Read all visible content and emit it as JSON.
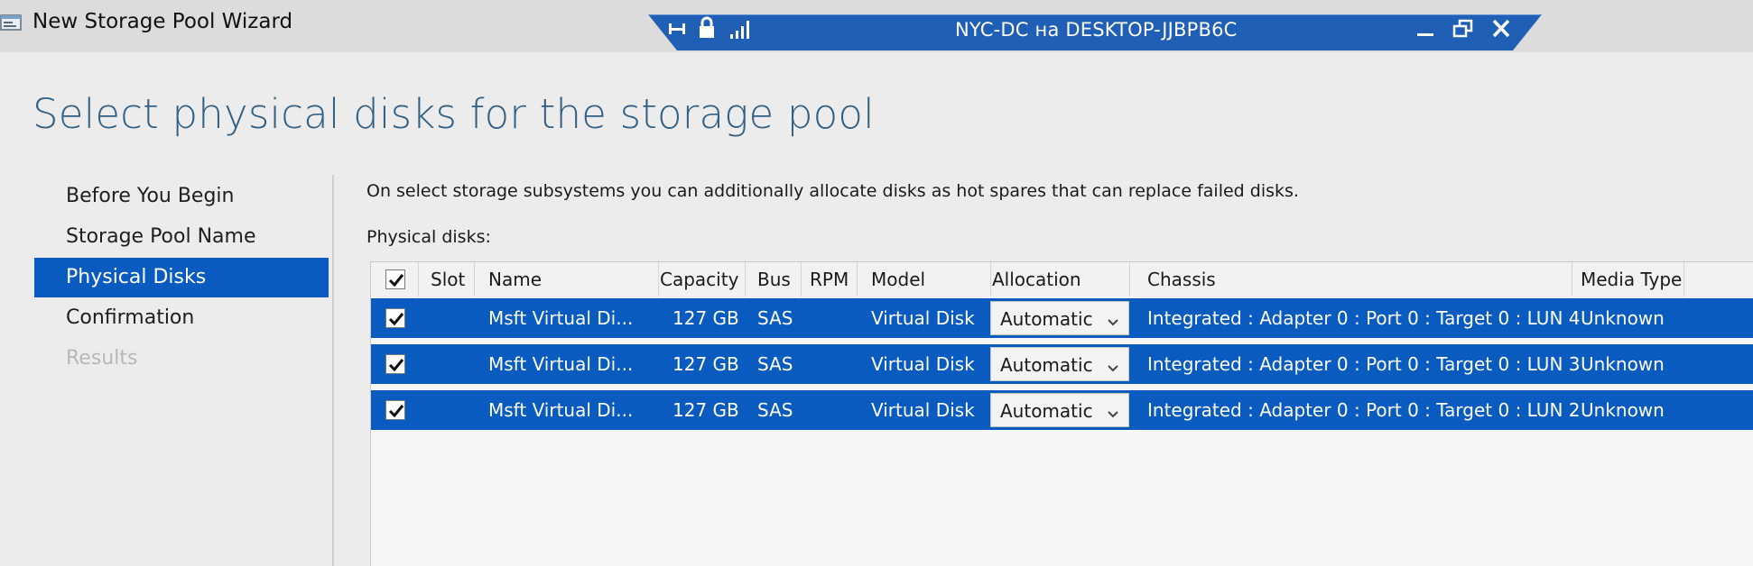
{
  "window": {
    "title": "New Storage Pool Wizard",
    "app_icon": "storage-pool-wizard-icon"
  },
  "rdp_bar": {
    "host": "NYC-DC на DESKTOP-JJBPB6C",
    "icons": [
      "pin-icon",
      "lock-icon",
      "signal-icon"
    ],
    "controls": [
      "minimize-icon",
      "restore-icon",
      "close-icon"
    ],
    "color": "#1f5fb5"
  },
  "page": {
    "title": "Select physical disks for the storage pool",
    "intro": "On select storage subsystems you can additionally allocate disks as hot spares that can replace failed disks.",
    "list_label": "Physical disks:"
  },
  "nav": {
    "items": [
      {
        "label": "Before You Begin",
        "state": "normal"
      },
      {
        "label": "Storage Pool Name",
        "state": "normal"
      },
      {
        "label": "Physical Disks",
        "state": "active"
      },
      {
        "label": "Confirmation",
        "state": "normal"
      },
      {
        "label": "Results",
        "state": "disabled"
      }
    ]
  },
  "grid": {
    "select_all_checked": true,
    "columns": [
      "Slot",
      "Name",
      "Capacity",
      "Bus",
      "RPM",
      "Model",
      "Allocation",
      "Chassis",
      "Media Type"
    ],
    "rows": [
      {
        "checked": true,
        "slot": "",
        "name": "Msft Virtual Di...",
        "capacity": "127 GB",
        "bus": "SAS",
        "rpm": "",
        "model": "Virtual Disk",
        "allocation": "Automatic",
        "chassis": "Integrated : Adapter 0 : Port 0 : Target 0 : LUN 4",
        "media_type": "Unknown"
      },
      {
        "checked": true,
        "slot": "",
        "name": "Msft Virtual Di...",
        "capacity": "127 GB",
        "bus": "SAS",
        "rpm": "",
        "model": "Virtual Disk",
        "allocation": "Automatic",
        "chassis": "Integrated : Adapter 0 : Port 0 : Target 0 : LUN 3",
        "media_type": "Unknown"
      },
      {
        "checked": true,
        "slot": "",
        "name": "Msft Virtual Di...",
        "capacity": "127 GB",
        "bus": "SAS",
        "rpm": "",
        "model": "Virtual Disk",
        "allocation": "Automatic",
        "chassis": "Integrated : Adapter 0 : Port 0 : Target 0 : LUN 2",
        "media_type": "Unknown"
      }
    ],
    "selected_row_color": "#0a5bbf"
  },
  "colors": {
    "accent": "#0a5bbf",
    "title_text": "#325f84",
    "background": "#ececec"
  }
}
